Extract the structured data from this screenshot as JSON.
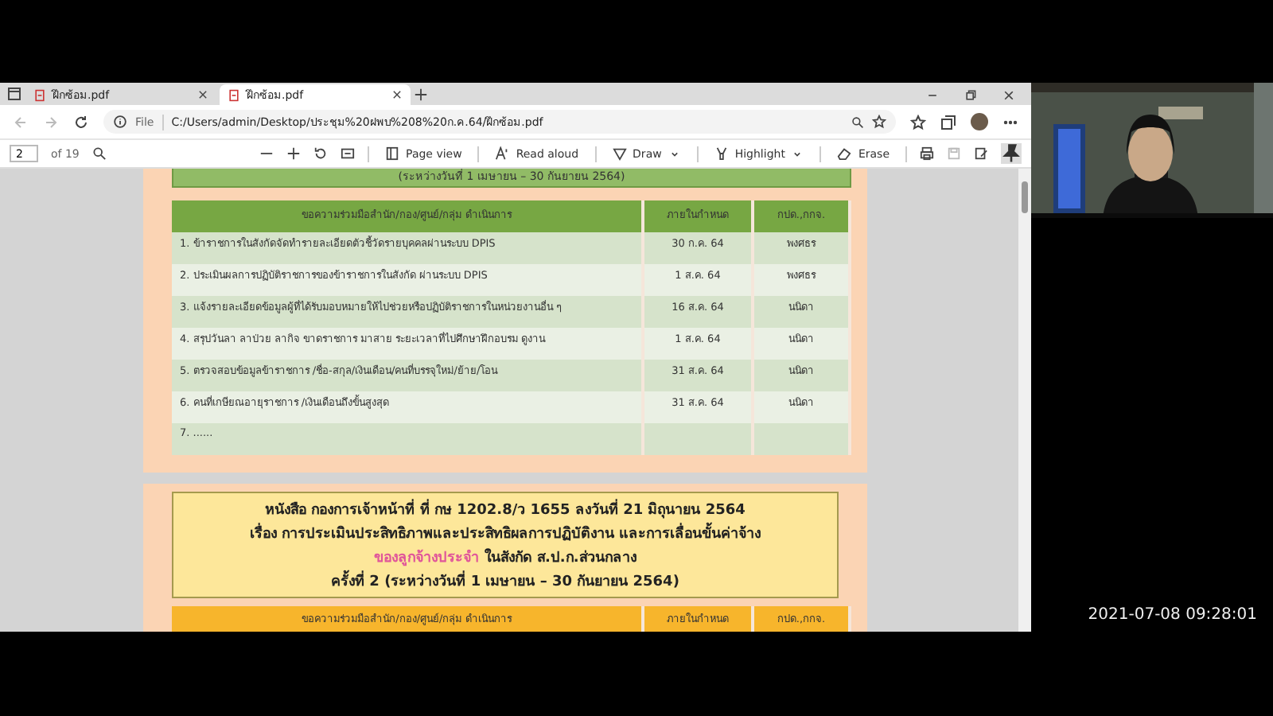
{
  "browser": {
    "tabs": [
      {
        "title": "ฝึกซ้อม.pdf",
        "selected": false
      },
      {
        "title": "ฝึกซ้อม.pdf",
        "selected": true
      }
    ],
    "address": {
      "scheme": "File",
      "url": "C:/Users/admin/Desktop/ประชุม%20ฝพบ%208%20ก.ค.64/ฝึกซ้อม.pdf"
    },
    "pdf_toolbar": {
      "page": "2",
      "page_count": "of 19",
      "buttons": [
        {
          "kind": "pageview",
          "label": "Page view",
          "dropdown": false
        },
        {
          "kind": "read",
          "label": "Read aloud",
          "dropdown": false
        },
        {
          "kind": "draw",
          "label": "Draw",
          "dropdown": true
        },
        {
          "kind": "highlight",
          "label": "Highlight",
          "dropdown": true
        },
        {
          "kind": "erase",
          "label": "Erase",
          "dropdown": false
        }
      ]
    }
  },
  "document": {
    "page_1": {
      "heading": "(ระหว่างวันที่ 1 เมษายน – 30 กันยายน 2564)",
      "table": {
        "columns": [
          "ขอความร่วมมือสำนัก/กอง/ศูนย์/กลุ่ม ดำเนินการ",
          "ภายในกำหนด",
          "กปด.,กกจ."
        ],
        "rows": [
          {
            "task": "1. ข้าราชการในสังกัดจัดทำรายละเอียดตัวชี้วัดรายบุคคลผ่านระบบ DPIS",
            "deadline": "30 ก.ค. 64",
            "owner": "พงศธร"
          },
          {
            "task": "2. ประเมินผลการปฏิบัติราชการของข้าราชการในสังกัด ผ่านระบบ DPIS",
            "deadline": "1 ส.ค. 64",
            "owner": "พงศธร"
          },
          {
            "task": "3. แจ้งรายละเอียดข้อมูลผู้ที่ได้รับมอบหมายให้ไปช่วยหรือปฏิบัติราชการในหน่วยงานอื่น ๆ",
            "deadline": "16 ส.ค. 64",
            "owner": "นนิดา"
          },
          {
            "task": "4. สรุปวันลา ลาป่วย ลากิจ ขาดราชการ มาสาย ระยะเวลาที่ไปศึกษาฝึกอบรม ดูงาน",
            "deadline": "1 ส.ค. 64",
            "owner": "นนิดา"
          },
          {
            "task": "5. ตรวจสอบข้อมูลข้าราชการ /ชื่อ-สกุล/เงินเดือน/คนที่บรรจุใหม่/ย้าย/โอน",
            "deadline": "31 ส.ค. 64",
            "owner": "นนิดา"
          },
          {
            "task": "6. คนที่เกษียณอายุราชการ /เงินเดือนถึงขั้นสูงสุด",
            "deadline": "31 ส.ค. 64",
            "owner": "นนิดา"
          },
          {
            "task": "7. ......"
          }
        ]
      }
    },
    "page_2": {
      "notice": [
        [
          {
            "text": "หนังสือ กองการเจ้าหน้าที่ ที่ กษ 1202.8/ว 1655 ลงวันที่ 21 มิถุนายน 2564",
            "highlight": false
          }
        ],
        [
          {
            "text": "เรื่อง การประเมินประสิทธิภาพและประสิทธิผลการปฏิบัติงาน และการเลื่อนขั้นค่าจ้าง",
            "highlight": false
          }
        ],
        [
          {
            "text": "ของลูกจ้างประจำ",
            "highlight": true
          },
          {
            "text": " ในสังกัด ส.ป.ก.ส่วนกลาง",
            "highlight": false
          }
        ],
        [
          {
            "text": "ครั้งที่ 2  (ระหว่างวันที่ 1 เมษายน – 30 กันยายน 2564)",
            "highlight": false
          }
        ]
      ],
      "table_columns": [
        "ขอความร่วมมือสำนัก/กอง/ศูนย์/กลุ่ม ดำเนินการ",
        "ภายในกำหนด",
        "กปด.,กกจ."
      ]
    }
  },
  "timestamp": "2021-07-08 09:28:01"
}
